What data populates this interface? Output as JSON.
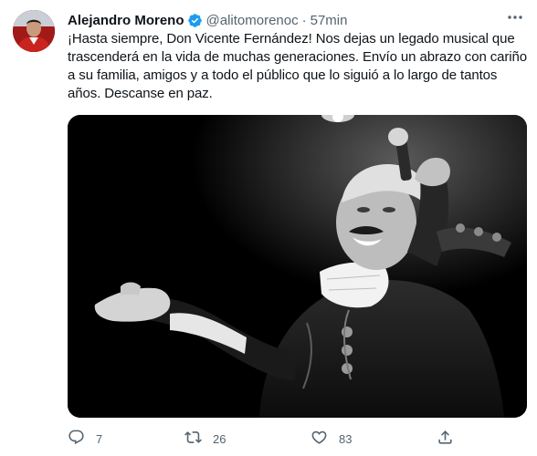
{
  "tweet": {
    "author": {
      "name": "Alejandro Moreno",
      "handle": "@alitomorenoc",
      "separator": "·",
      "time": "57min",
      "avatar_icon": "profile-photo",
      "verified_icon": "verified-badge-icon"
    },
    "text": "¡Hasta siempre, Don Vicente Fernández! Nos dejas un legado musical que trascenderá en la vida de muchas generaciones. Envío un abrazo con cariño a su familia, amigos y a todo el público que lo siguió a lo largo de tantos años. Descanse en paz.",
    "media": {
      "type": "photo",
      "style": "black-and-white"
    },
    "actions": {
      "reply_count": "7",
      "retweet_count": "26",
      "like_count": "83"
    }
  },
  "colors": {
    "text_primary": "#0f1419",
    "text_secondary": "#536471",
    "verified_blue": "#1d9bf0"
  }
}
